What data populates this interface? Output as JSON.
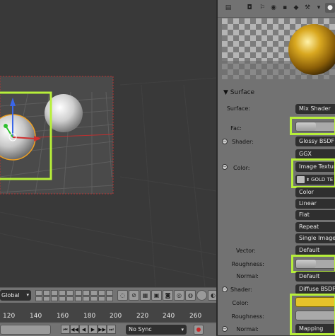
{
  "viewport": {
    "transform_orientation": "Global"
  },
  "timeline": {
    "ticks": [
      "120",
      "140",
      "160",
      "180",
      "200",
      "220",
      "240",
      "260"
    ],
    "sync": "No Sync"
  },
  "properties": {
    "section_title": "Surface",
    "surface_label": "Surface:",
    "surface_value": "Mix Shader",
    "fac_label": "Fac:",
    "fac_value": 0.5,
    "shader1_label": "Shader:",
    "shader1_value": "Glossy BSDF",
    "distribution_value": "GGX",
    "color1_label": "Color:",
    "color1_value": "Image Texture",
    "image_name": "GOLD TE",
    "color_space": "Color",
    "interpolation": "Linear",
    "projection": "Flat",
    "extension": "Repeat",
    "source": "Single Image",
    "vector_label": "Vector:",
    "vector_value": "Default",
    "roughness1_label": "Roughness:",
    "roughness1_value": 0.5,
    "normal1_label": "Normal:",
    "normal1_value": "Default",
    "shader2_label": "Shader:",
    "shader2_value": "Diffuse BSDF",
    "color2_label": "Color:",
    "color2_hex": "#e6c32a",
    "roughness2_label": "Roughness:",
    "normal2_label": "Normal:",
    "normal2_value": "Mapping"
  },
  "colors": {
    "highlight": "#b7ef3a",
    "gold": "#e6c32a"
  }
}
